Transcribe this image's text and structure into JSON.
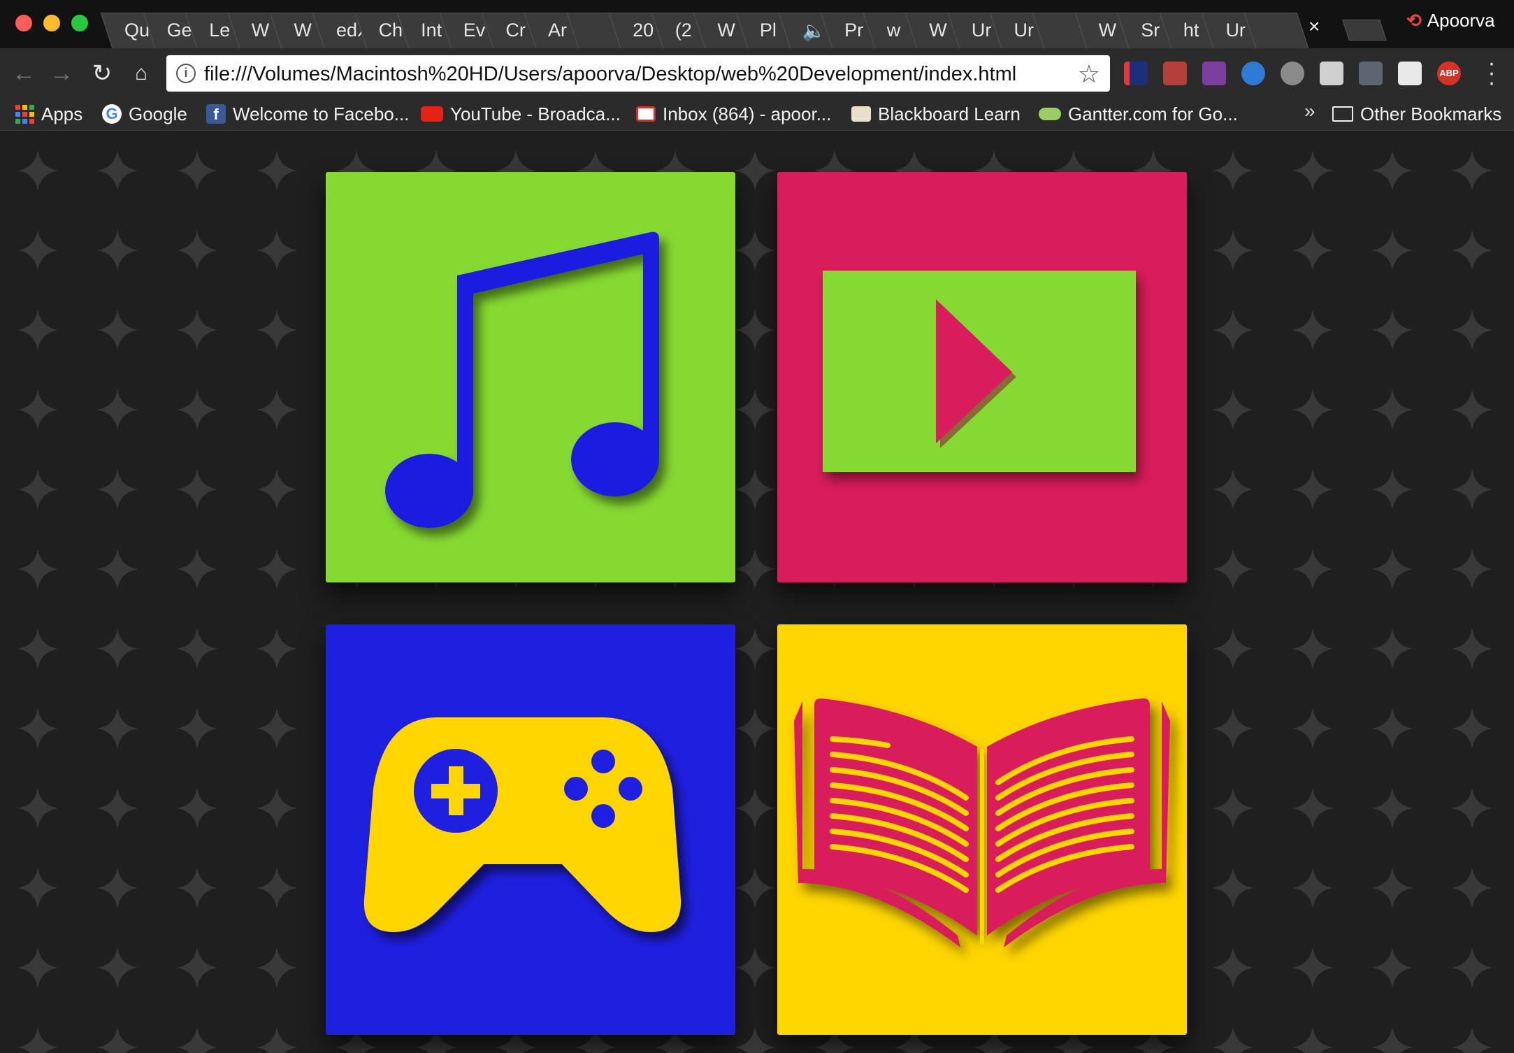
{
  "browser": {
    "tabs": [
      {
        "label": "Qu"
      },
      {
        "label": "Ge"
      },
      {
        "label": "Le"
      },
      {
        "label": "W"
      },
      {
        "label": "W"
      },
      {
        "label": "edX"
      },
      {
        "label": "Ch"
      },
      {
        "label": "Int"
      },
      {
        "label": "Ev"
      },
      {
        "label": "Cr"
      },
      {
        "label": "Ar"
      },
      {
        "label": ""
      },
      {
        "label": "20"
      },
      {
        "label": "(2"
      },
      {
        "label": "W"
      },
      {
        "label": "Pl"
      },
      {
        "label": "🔈"
      },
      {
        "label": "Pr"
      },
      {
        "label": "w"
      },
      {
        "label": "W"
      },
      {
        "label": "Ur"
      },
      {
        "label": "Ur"
      },
      {
        "label": ""
      },
      {
        "label": "W"
      },
      {
        "label": "Sr"
      },
      {
        "label": "ht"
      },
      {
        "label": "Ur"
      },
      {
        "label": ""
      }
    ],
    "close_tab": "×",
    "profile_name": "Apoorva",
    "url": "file:///Volumes/Macintosh%20HD/Users/apoorva/Desktop/web%20Development/index.html"
  },
  "bookmarks": {
    "apps": "Apps",
    "items": [
      {
        "label": "Google"
      },
      {
        "label": "Welcome to Facebo..."
      },
      {
        "label": "YouTube - Broadca..."
      },
      {
        "label": "Inbox (864) - apoor..."
      },
      {
        "label": "Blackboard Learn"
      },
      {
        "label": "Gantter.com for Go..."
      }
    ],
    "overflow": "»",
    "other": "Other Bookmarks"
  },
  "tiles": [
    {
      "name": "music",
      "bg": "#86d931",
      "fg": "#1f1fe0"
    },
    {
      "name": "video",
      "bg": "#d91c5c",
      "fg": "#86d931"
    },
    {
      "name": "game",
      "bg": "#1f1fe0",
      "fg": "#ffd600"
    },
    {
      "name": "book",
      "bg": "#ffd600",
      "fg": "#d91c5c"
    }
  ],
  "colors": {
    "page_bg": "#201f20",
    "star_pattern": "#3a393a"
  }
}
